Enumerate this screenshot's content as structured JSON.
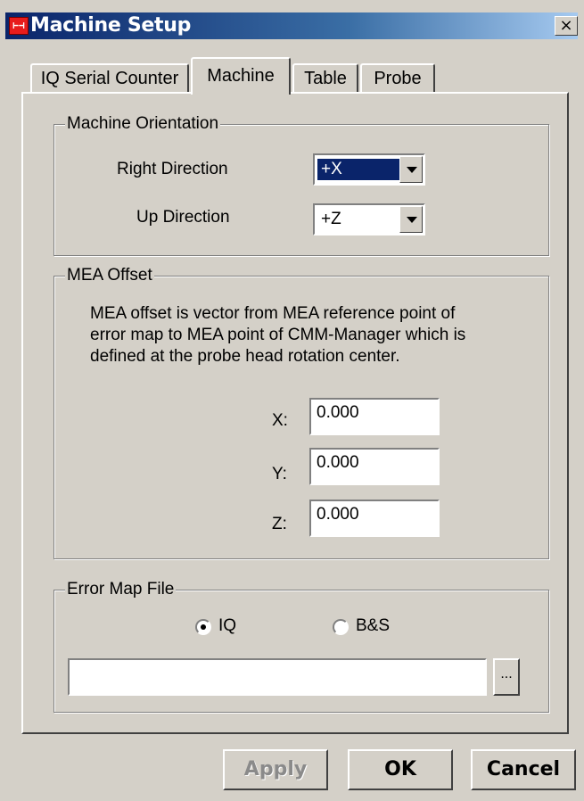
{
  "window": {
    "title": "Machine Setup",
    "close_label": "×",
    "icon_text": "⊢⊣"
  },
  "tabs": [
    {
      "label": "IQ Serial Counter"
    },
    {
      "label": "Machine"
    },
    {
      "label": "Table"
    },
    {
      "label": "Probe"
    }
  ],
  "active_tab": "Machine",
  "orientation": {
    "legend": "Machine Orientation",
    "right_label": "Right Direction",
    "right_value": "+X",
    "up_label": "Up Direction",
    "up_value": "+Z"
  },
  "mea": {
    "legend": "MEA Offset",
    "description_line1": "MEA offset is vector from MEA reference point of",
    "description_line2": "error map to MEA point of CMM-Manager which is",
    "description_line3": "defined at the probe head rotation center.",
    "x_label": "X:",
    "x_value": "0.000",
    "y_label": "Y:",
    "y_value": "0.000",
    "z_label": "Z:",
    "z_value": "0.000"
  },
  "error_map": {
    "legend": "Error Map File",
    "option_iq": "IQ",
    "option_bs": "B&S",
    "selected": "IQ",
    "file_path": "",
    "browse_label": "..."
  },
  "buttons": {
    "apply": "Apply",
    "ok": "OK",
    "cancel": "Cancel"
  },
  "colors": {
    "title_bar_start": "#0a246a",
    "title_bar_end": "#a6caf0",
    "face": "#d4d0c8",
    "selection": "#0a246a"
  }
}
